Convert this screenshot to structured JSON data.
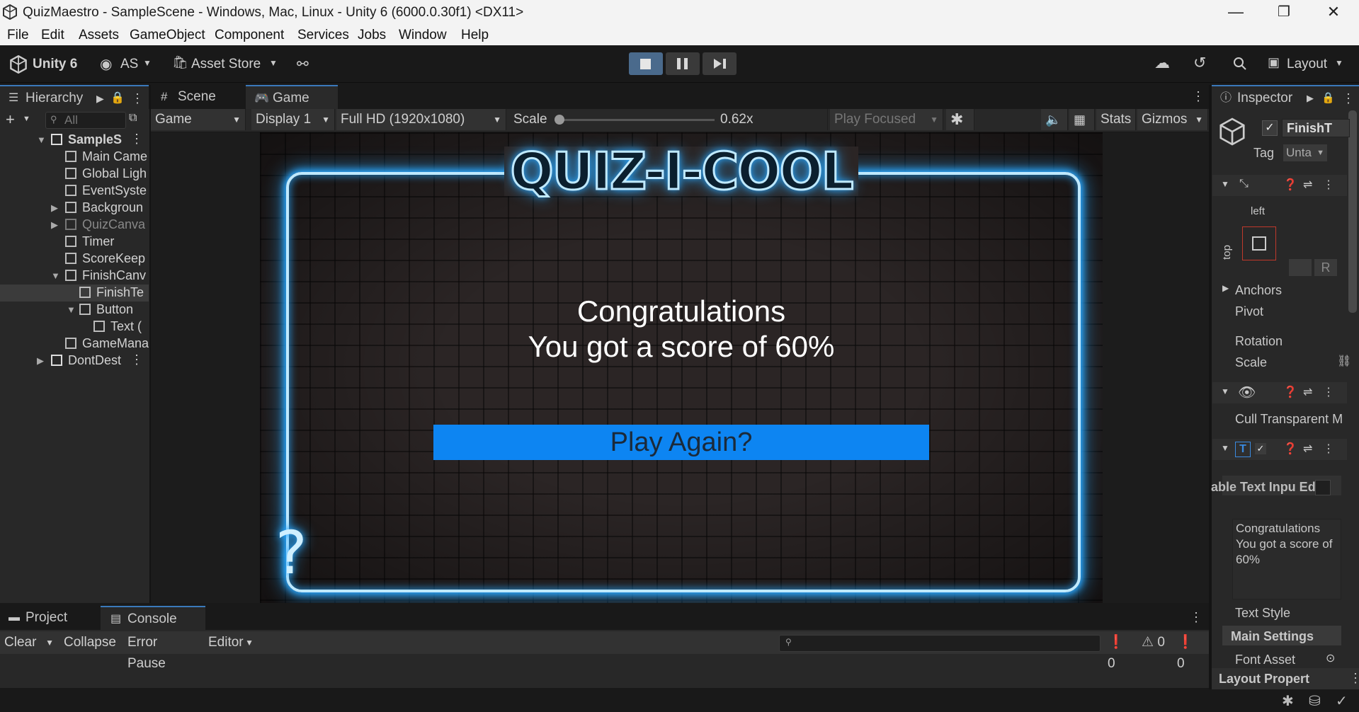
{
  "window": {
    "title": "QuizMaestro - SampleScene - Windows, Mac, Linux - Unity 6 (6000.0.30f1) <DX11>",
    "minimize": "—",
    "maximize": "❐",
    "close": "✕"
  },
  "menu": [
    "File",
    "Edit",
    "Assets",
    "GameObject",
    "Component",
    "Services",
    "Jobs",
    "Window",
    "Help"
  ],
  "toolbar": {
    "unity_label": "Unity 6",
    "account_label": "AS",
    "asset_store_label": "Asset Store",
    "layout_label": "Layout"
  },
  "hierarchy": {
    "tab_label": "Hierarchy",
    "search_placeholder": "All",
    "rows": [
      {
        "label": "SampleS",
        "indent": 0
      },
      {
        "label": "Main Came",
        "indent": 1
      },
      {
        "label": "Global Ligh",
        "indent": 1
      },
      {
        "label": "EventSyste",
        "indent": 1
      },
      {
        "label": "Backgroun",
        "indent": 1
      },
      {
        "label": "QuizCanva",
        "indent": 1
      },
      {
        "label": "Timer",
        "indent": 1
      },
      {
        "label": "ScoreKeep",
        "indent": 1
      },
      {
        "label": "FinishCanv",
        "indent": 1
      },
      {
        "label": "FinishTe",
        "indent": 2
      },
      {
        "label": "Button",
        "indent": 2
      },
      {
        "label": "Text (",
        "indent": 3
      },
      {
        "label": "GameMana",
        "indent": 1
      },
      {
        "label": "DontDest",
        "indent": 0
      }
    ]
  },
  "scene_tabs": {
    "scene_label": "Scene",
    "game_label": "Game"
  },
  "game_toolbar": {
    "mode": "Game",
    "display": "Display 1",
    "resolution": "Full HD (1920x1080)",
    "scale_label": "Scale",
    "scale_value": "0.62x",
    "play_focus": "Play Focused",
    "stats": "Stats",
    "gizmos": "Gizmos",
    "scale_fraction": 0.0
  },
  "game": {
    "logo": "QUIZ-I-COOL",
    "congrats_line1": "Congratulations",
    "congrats_line2": "You got a score of 60%",
    "button_label": "Play Again?",
    "qmark": "?"
  },
  "inspector": {
    "tab_label": "Inspector",
    "object_name": "FinishT",
    "tag_label": "Tag",
    "tag_value": "Unta",
    "left_label": "left",
    "top_label": "top",
    "anchors": "Anchors",
    "pivot": "Pivot",
    "rotation": "Rotation",
    "scale": "Scale",
    "cull_label": "Cull Transparent M",
    "text_input_overlay": "able Text Inpu Editor",
    "text_value": "Congratulations You got a score of 60%",
    "text_style": "Text Style",
    "main_settings": "Main Settings",
    "font_asset": "Font Asset",
    "layout_properties": "Layout Propert"
  },
  "bottom": {
    "project_tab": "Project",
    "console_tab": "Console",
    "clear": "Clear",
    "collapse": "Collapse",
    "error_pause": "Error Pause",
    "editor": "Editor",
    "info_count": "0",
    "warn_count": "0",
    "error_count": "0"
  }
}
